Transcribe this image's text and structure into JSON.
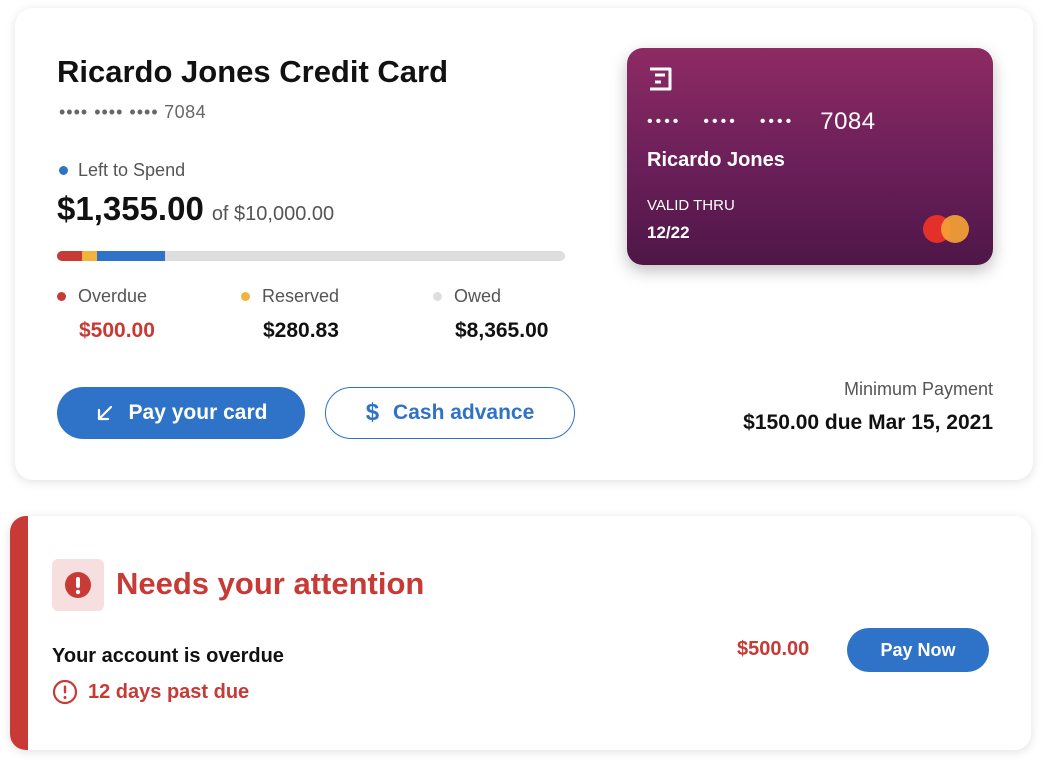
{
  "account": {
    "title": "Ricardo Jones Credit Card",
    "masked_dots": "•••• •••• ••••",
    "last4": "7084"
  },
  "spend": {
    "label": "Left to Spend",
    "amount": "$1,355.00",
    "of_limit": "of $10,000.00",
    "limit_value": 10000,
    "overdue_value": 500,
    "reserved_value": 280.83,
    "left_value": 1355
  },
  "legend": {
    "overdue_label": "Overdue",
    "overdue_value": "$500.00",
    "reserved_label": "Reserved",
    "reserved_value": "$280.83",
    "owed_label": "Owed",
    "owed_value": "$8,365.00"
  },
  "actions": {
    "pay_label": "Pay your card",
    "cash_label": "Cash advance"
  },
  "minimum_payment": {
    "label": "Minimum Payment",
    "value": "$150.00 due Mar 15, 2021"
  },
  "card": {
    "dots1": "••••",
    "dots2": "••••",
    "dots3": "••••",
    "last4": "7084",
    "holder": "Ricardo Jones",
    "valid_label": "VALID THRU",
    "valid_value": "12/22",
    "brand_icon": "mastercard-logo-icon",
    "issuer_icon": "bank-logo-icon"
  },
  "alert": {
    "title": "Needs your attention",
    "message": "Your account is overdue",
    "past_due": "12 days past due",
    "amount": "$500.00",
    "pay_now_label": "Pay Now"
  },
  "colors": {
    "accent": "#2f73c8",
    "danger": "#c73a35",
    "reserved": "#f0b43c",
    "owed": "#dedede",
    "card_top": "#8e2a63",
    "card_bottom": "#4e1647"
  }
}
